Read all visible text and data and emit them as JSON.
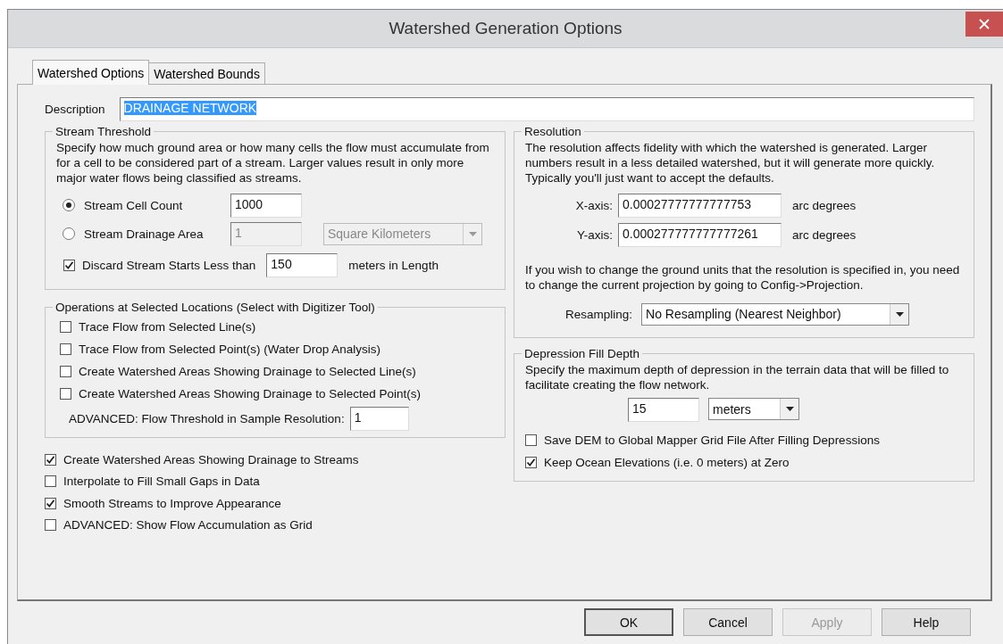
{
  "window": {
    "title": "Watershed Generation Options"
  },
  "tabs": [
    {
      "label": "Watershed Options",
      "selected": true
    },
    {
      "label": "Watershed Bounds",
      "selected": false
    }
  ],
  "description": {
    "label": "Description",
    "value": "DRAINAGE NETWORK",
    "highlighted": true
  },
  "stream_threshold": {
    "title": "Stream Threshold",
    "text": "Specify how much ground area or how many cells the flow must accumulate from for a cell to be considered part of a stream. Larger values result in only more major water flows being classified as streams.",
    "rows": [
      {
        "label": "Stream Cell Count",
        "selected": true,
        "value": "1000",
        "disabled": false
      },
      {
        "label": "Stream Drainage Area",
        "selected": false,
        "value": "1",
        "disabled": true,
        "unit": "Square Kilometers"
      }
    ],
    "discard": {
      "label": "Discard Stream Starts Less than",
      "checked": true,
      "value": "150",
      "suffix": "meters in Length"
    }
  },
  "operations": {
    "title": "Operations at Selected Locations (Select with Digitizer Tool)",
    "items": [
      {
        "label": "Trace Flow from Selected Line(s)",
        "checked": false
      },
      {
        "label": "Trace Flow from Selected Point(s) (Water Drop Analysis)",
        "checked": false
      },
      {
        "label": "Create Watershed Areas Showing Drainage to Selected Line(s)",
        "checked": false
      },
      {
        "label": "Create Watershed Areas Showing Drainage to Selected Point(s)",
        "checked": false
      }
    ],
    "advanced": {
      "label": "ADVANCED: Flow Threshold in Sample Resolution:",
      "value": "1"
    }
  },
  "options": [
    {
      "label": "Create Watershed Areas Showing Drainage to Streams",
      "checked": true
    },
    {
      "label": "Interpolate to Fill Small Gaps in Data",
      "checked": false
    },
    {
      "label": "Smooth Streams to Improve Appearance",
      "checked": true
    },
    {
      "label": "ADVANCED: Show Flow Accumulation as Grid",
      "checked": false
    }
  ],
  "resolution": {
    "title": "Resolution",
    "text": "The resolution affects fidelity with which the watershed is generated. Larger numbers result in a less detailed watershed, but it will generate more quickly. Typically you'll just want to accept the defaults.",
    "axes": [
      {
        "label": "X-axis:",
        "value": "0.00027777777777753",
        "unit": "arc degrees"
      },
      {
        "label": "Y-axis:",
        "value": "0.000277777777777261",
        "unit": "arc degrees"
      }
    ],
    "note": "If you wish to change the ground units that the resolution is specified in, you need to change the current projection by going to Config->Projection.",
    "resampling": {
      "label": "Resampling:",
      "value": "No Resampling (Nearest Neighbor)"
    }
  },
  "depression": {
    "title": "Depression Fill Depth",
    "text": "Specify the maximum depth of depression in the terrain data that will be filled to facilitate creating the flow network.",
    "value": "15",
    "unit": "meters",
    "checks": [
      {
        "label": "Save DEM to Global Mapper Grid File After Filling Depressions",
        "checked": false
      },
      {
        "label": "Keep Ocean Elevations (i.e. 0 meters) at Zero",
        "checked": true
      }
    ]
  },
  "buttons": [
    {
      "label": "OK",
      "disabled": false,
      "default": true
    },
    {
      "label": "Cancel",
      "disabled": false,
      "default": false
    },
    {
      "label": "Apply",
      "disabled": true,
      "default": false
    },
    {
      "label": "Help",
      "disabled": false,
      "default": false
    }
  ]
}
